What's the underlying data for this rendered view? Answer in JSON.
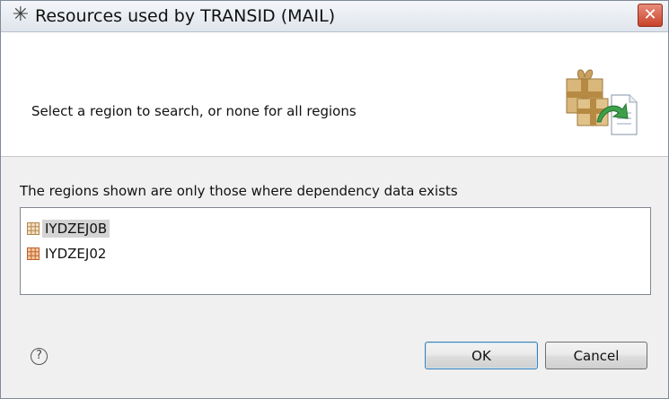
{
  "window": {
    "title": "Resources used by  TRANSID (MAIL)",
    "title_icon": "asterisk-icon",
    "close_icon": "close-icon",
    "close_glyph": "✕"
  },
  "header": {
    "message": "Select a region to search, or none for all regions",
    "art": "packages-arrow-document-icon"
  },
  "regions": {
    "info": "The regions shown are only those where dependency data exists",
    "items": [
      {
        "label": "IYDZEJ0B",
        "selected": true
      },
      {
        "label": "IYDZEJ02",
        "selected": false
      }
    ]
  },
  "footer": {
    "help_glyph": "?",
    "ok_label": "OK",
    "cancel_label": "Cancel"
  }
}
